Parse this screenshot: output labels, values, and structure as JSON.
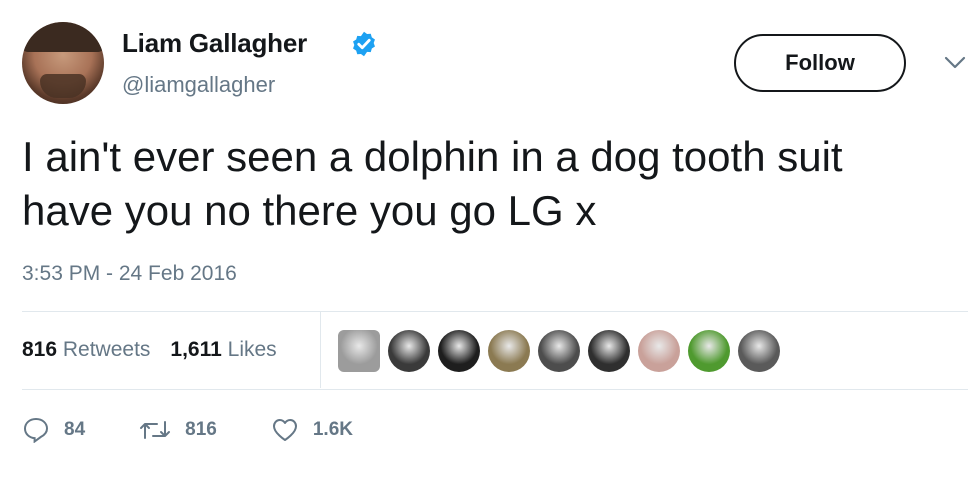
{
  "user": {
    "name": "Liam Gallagher",
    "handle": "@liamgallagher",
    "verified_color": "#1da1f2"
  },
  "follow": {
    "label": "Follow"
  },
  "tweet": {
    "text": "I ain't ever seen a dolphin in a dog tooth suit\nhave you no there you go LG x",
    "timestamp": "3:53 PM - 24 Feb 2016"
  },
  "stats": {
    "retweets_count": "816",
    "retweets_label": " Retweets",
    "likes_count": "1,611",
    "likes_label": " Likes"
  },
  "likers": [
    {
      "icon": "liker-avatar",
      "color": "#9c9c9c"
    },
    {
      "icon": "liker-avatar",
      "color": "#3a3a3a"
    },
    {
      "icon": "liker-avatar",
      "color": "#1e1e1e"
    },
    {
      "icon": "liker-avatar",
      "color": "#8b7a52"
    },
    {
      "icon": "liker-avatar",
      "color": "#4d4d4d"
    },
    {
      "icon": "liker-avatar",
      "color": "#2f2f2f"
    },
    {
      "icon": "liker-avatar",
      "color": "#c9a19a"
    },
    {
      "icon": "liker-avatar",
      "color": "#4f9a2f"
    },
    {
      "icon": "liker-avatar",
      "color": "#5a5a5a"
    }
  ],
  "actions": {
    "replies": "84",
    "retweets": "816",
    "likes": "1.6K"
  }
}
